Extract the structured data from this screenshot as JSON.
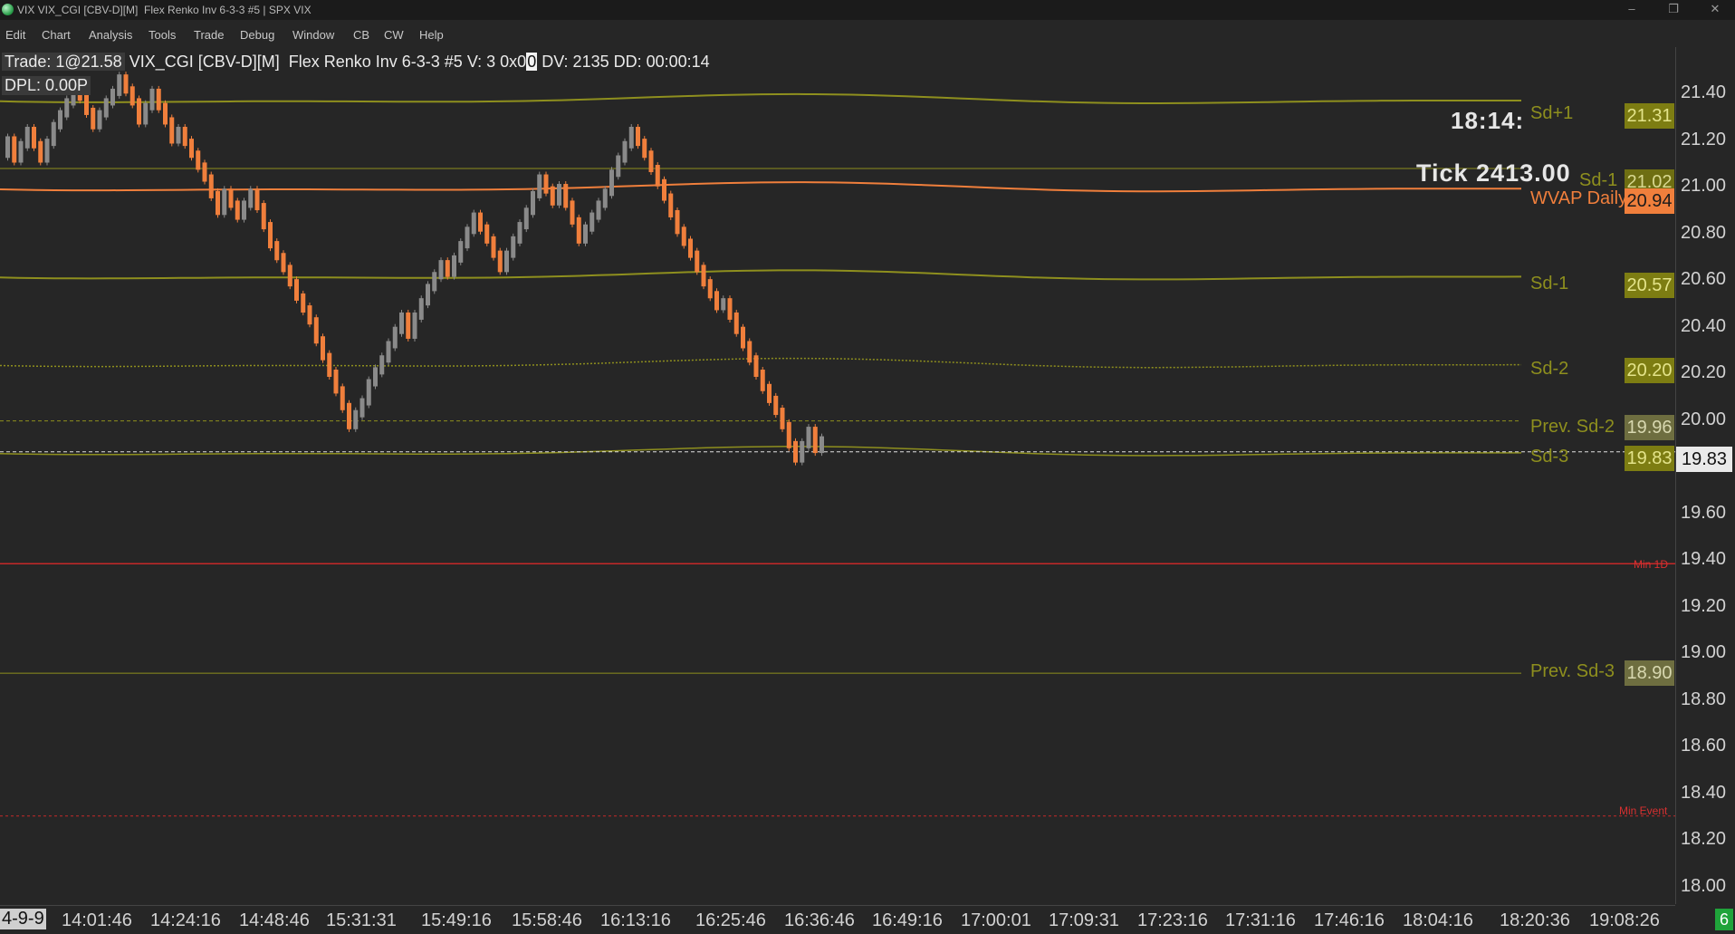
{
  "window": {
    "title": "VIX VIX_CGI [CBV-D][M]  Flex Renko Inv 6-3-3 #5 | SPX VIX"
  },
  "menu": [
    "Edit",
    "Chart",
    "Analysis",
    "Tools",
    "Trade",
    "Debug",
    "Window",
    "CB",
    "CW",
    "Help"
  ],
  "info": {
    "trade": "Trade: 1@21.58",
    "line1_rest": " VIX_CGI [CBV-D][M]  Flex Renko Inv 6-3-3 #5 V: 3 0x0",
    "highlight": "0",
    "line1_tail": " DV: 2135 DD: 00:00:14",
    "dpl": "DPL: 0.00P"
  },
  "overlay": {
    "clock": "18:14:",
    "tick": "Tick 2413.00"
  },
  "colors": {
    "up": "#8a8a8a",
    "down": "#f07f3c",
    "band": "#8e8f1e",
    "wvap": "#f07f3c",
    "min_line": "#c62828",
    "background": "#262626"
  },
  "chart_data": {
    "type": "renko",
    "yaxis": {
      "ticks": [
        "21.40",
        "21.20",
        "21.00",
        "20.80",
        "20.60",
        "20.40",
        "20.20",
        "20.00",
        "19.80",
        "19.60",
        "19.40",
        "19.20",
        "19.00",
        "18.80",
        "18.60",
        "18.40",
        "18.20",
        "18.00"
      ],
      "ylim": [
        17.93,
        21.53
      ]
    },
    "xaxis": {
      "ticks": [
        "14:01:46",
        "14:24:16",
        "14:48:46",
        "15:31:31",
        "15:49:16",
        "15:58:46",
        "16:13:16",
        "16:25:46",
        "16:36:46",
        "16:49:16",
        "17:00:01",
        "17:09:31",
        "17:23:16",
        "17:31:16",
        "17:46:16",
        "18:04:16",
        "18:20:36",
        "19:08:26"
      ],
      "first_partial": "4-9-9"
    },
    "last_price": "19.83",
    "price_path": [
      21.08,
      21.14,
      21.06,
      21.18,
      21.12,
      21.06,
      21.2,
      21.3,
      21.38,
      21.26,
      21.2,
      21.3,
      21.34,
      21.4,
      21.3,
      21.22,
      21.28,
      21.34,
      21.22,
      21.14,
      21.18,
      21.08,
      20.98,
      20.84,
      20.92,
      20.82,
      20.92,
      20.86,
      20.78,
      20.7,
      20.6,
      20.48,
      20.38,
      20.3,
      20.16,
      20.02,
      19.94,
      20.04,
      20.12,
      20.22,
      20.34,
      20.4,
      20.32,
      20.4,
      20.52,
      20.62,
      20.58,
      20.64,
      20.7,
      20.76,
      20.82,
      20.72,
      20.66,
      20.6,
      20.72,
      20.84,
      20.98,
      20.88,
      20.94,
      20.8,
      20.72,
      20.82,
      20.92,
      21.0,
      21.12,
      21.18,
      21.08,
      20.96,
      20.9,
      20.76,
      20.66,
      20.54,
      20.44,
      20.46,
      20.34,
      20.22,
      20.1,
      20.0,
      19.94,
      19.86,
      19.8,
      19.86,
      19.92,
      19.84,
      19.88
    ],
    "levels": [
      {
        "label": "Sd+1",
        "badge": "21.31",
        "value": 21.31
      },
      {
        "label": "Sd-1",
        "badge": "21.02",
        "value": 21.02
      },
      {
        "label": "WVAP Daily",
        "badge": "20.94",
        "value": 20.94
      },
      {
        "label": "Sd-1",
        "badge": "20.57",
        "value": 20.57
      },
      {
        "label": "Sd-2",
        "badge": "20.20",
        "value": 20.2
      },
      {
        "label": "Prev. Sd-2",
        "badge": "19.96",
        "value": 19.96
      },
      {
        "label": "Sd-3",
        "badge": "19.83",
        "value": 19.83
      },
      {
        "label": "Prev. Sd-3",
        "badge": "18.90",
        "value": 18.9
      }
    ],
    "min_lines": [
      {
        "label": "Min 1D",
        "value": 19.36
      },
      {
        "label": "Min Event",
        "value": 18.3
      }
    ]
  },
  "badge": {
    "corner": "6"
  }
}
